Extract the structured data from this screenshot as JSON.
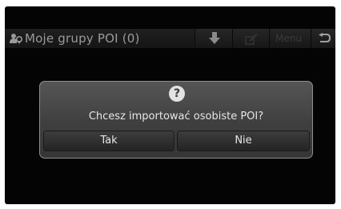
{
  "titlebar": {
    "title": "Moje grupy POI (0)",
    "title_icon": "user-location-icon",
    "menu_label": "Menu",
    "icons": [
      "download-icon",
      "edit-icon",
      "back-icon"
    ]
  },
  "dialog": {
    "icon": "question-icon",
    "icon_glyph": "?",
    "message": "Chcesz importować osobiste POI?",
    "yes_label": "Tak",
    "no_label": "Nie"
  },
  "colors": {
    "screen_bg": "#040404",
    "titlebar_bg": "#1a1a1a",
    "title_text": "#9a9a9a",
    "dialog_bg": "#464646",
    "dialog_border": "#8e8e8e",
    "text": "#e6e6e6"
  }
}
